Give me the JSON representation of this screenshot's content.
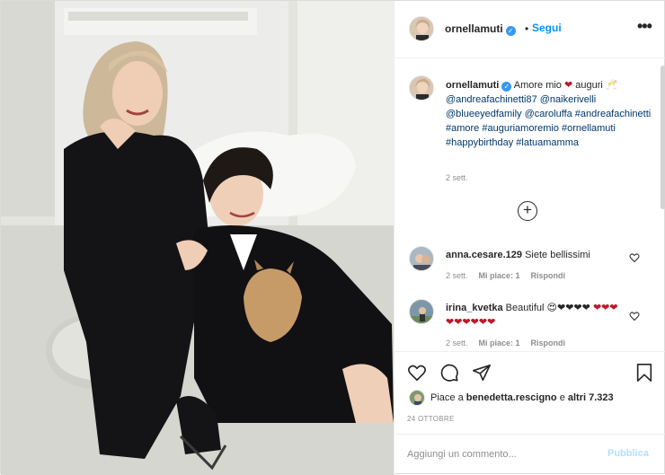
{
  "post": {
    "username": "ornellamuti",
    "follow_label": "Segui",
    "dot": "•",
    "more_glyph": "•••",
    "caption_text": "Amore mio",
    "caption_emoji": "🥂",
    "caption_mentions": "@andreafachinetti87 @naikerivelli @blueeyedfamily @caroluffa #andreafachinetti #amore #auguriamoremio #ornellamuti #happybirthday #latuamamma",
    "caption_time": "2 sett.",
    "likes_prefix": "Piace a",
    "likes_user": "benedetta.rescigno",
    "likes_middle": "e",
    "likes_rest": "altri 7.323",
    "date": "24 OTTOBRE",
    "add_comment_placeholder": "Aggiungi un commento...",
    "publish_label": "Pubblica"
  },
  "comments": [
    {
      "user": "anna.cesare.129",
      "text": "Siete bellissimi",
      "time": "2 sett.",
      "likes": "Mi piace: 1",
      "reply": "Rispondi"
    },
    {
      "user": "irina_kvetka",
      "text": "Beautiful 😍❤❤❤❤",
      "text2": "❤❤❤❤❤❤❤❤❤",
      "time": "2 sett.",
      "likes": "Mi piace: 1",
      "reply": "Rispondi"
    }
  ],
  "icons": [
    "more-options-icon",
    "verified-icon",
    "plus-circle-icon",
    "heart-icon",
    "comment-icon",
    "share-icon",
    "bookmark-icon"
  ],
  "colors": {
    "link": "#0095f6",
    "tag": "#00376b",
    "heart": "#c0182b",
    "muted": "#8e8e8e",
    "publish": "#b2dffc"
  }
}
